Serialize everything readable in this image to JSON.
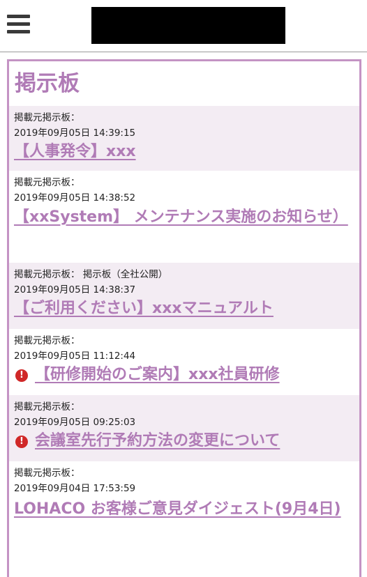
{
  "header": {
    "menu_icon": "hamburger-menu-icon",
    "logo": "redacted"
  },
  "board": {
    "title": "掲示板",
    "posts": [
      {
        "source_label": "掲載元掲示板：",
        "source_value": "",
        "datetime": "2019年09月05日 14:39:15",
        "title": "【人事発令】xxx",
        "alert": false
      },
      {
        "source_label": "掲載元掲示板：",
        "source_value": "",
        "datetime": "2019年09月05日 14:38:52",
        "title": "【xxSystem】 メンテナンス実施のお知らせ）",
        "alert": false
      },
      {
        "source_label": "掲載元掲示板：",
        "source_value": " 掲示板（全社公開）",
        "datetime": "2019年09月05日 14:38:37",
        "title": "【ご利用ください】xxxマニュアルト",
        "alert": false
      },
      {
        "source_label": "掲載元掲示板：",
        "source_value": "",
        "datetime": "2019年09月05日 11:12:44",
        "title": "【研修開始のご案内】xxx社員研修",
        "alert": true
      },
      {
        "source_label": "掲載元掲示板：",
        "source_value": "",
        "datetime": "2019年09月05日 09:25:03",
        "title": "会議室先行予約方法の変更について",
        "alert": true
      },
      {
        "source_label": "掲載元掲示板：",
        "source_value": "",
        "datetime": "2019年09月04日 17:53:59",
        "title": "LOHACO お客様ご意見ダイジェスト(9月4日)",
        "alert": false
      }
    ]
  },
  "colors": {
    "accent": "#b07bb6",
    "border": "#c493c4",
    "row_shade": "#f3ecf3",
    "alert": "#d02828"
  }
}
